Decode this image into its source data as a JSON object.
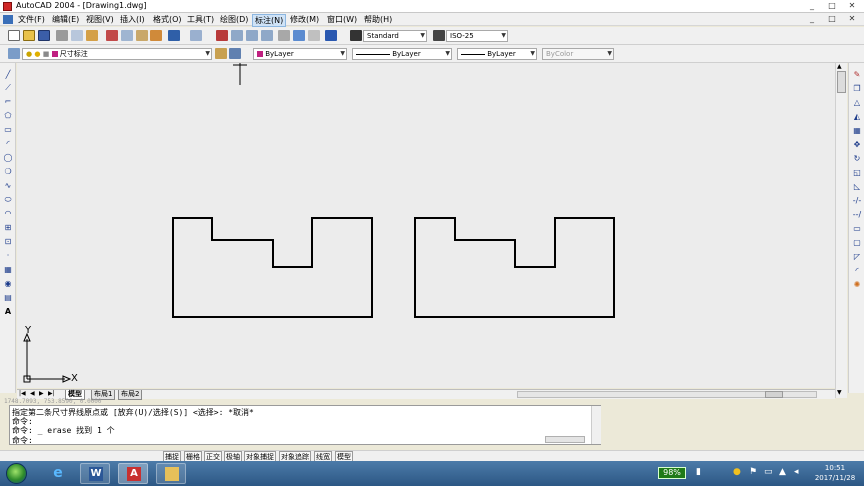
{
  "window": {
    "title": "AutoCAD 2004 - [Drawing1.dwg]",
    "controls": [
      "_",
      "□",
      "✕"
    ],
    "doc_controls": [
      "_",
      "□",
      "✕"
    ]
  },
  "menu": [
    "文件(F)",
    "编辑(E)",
    "视图(V)",
    "插入(I)",
    "格式(O)",
    "工具(T)",
    "绘图(D)",
    "标注(N)",
    "修改(M)",
    "窗口(W)",
    "帮助(H)"
  ],
  "active_menu": "标注(N)",
  "styles_toolbar": {
    "text_style": "Standard",
    "dim_style": "ISO-25"
  },
  "properties_toolbar": {
    "layer": "尺寸标注",
    "color": "ByLayer",
    "linetype": "ByLayer",
    "lineweight": "ByLayer",
    "plotstyle": "ByColor",
    "layer_color": "#c02080"
  },
  "ucs": {
    "x_label": "X",
    "y_label": "Y"
  },
  "tabs": [
    "模型",
    "布局1",
    "布局2"
  ],
  "active_tab": "模型",
  "command_lines": [
    "指定第二条尺寸界线原点或 [放弃(U)/选择(S)] <选择>: *取消*",
    "命令:",
    "命令: _ erase 找到 1 个",
    "命令:"
  ],
  "coords": "1748.7093, 753.8590, 0.0000",
  "status": [
    "捕捉",
    "栅格",
    "正交",
    "极轴",
    "对象捕捉",
    "对象追踪",
    "线宽",
    "模型"
  ],
  "taskbar": {
    "battery": "98%",
    "time": "10:51",
    "date": "2017/11/28"
  },
  "colors": {
    "canvas": "#ececec",
    "taskbar": "#2c5784",
    "active_menu": "#cfe3f7"
  },
  "left_tool_icons": [
    "line-icon",
    "construction-line-icon",
    "polyline-icon",
    "polygon-icon",
    "rectangle-icon",
    "arc-icon",
    "circle-icon",
    "revision-cloud-icon",
    "spline-icon",
    "ellipse-icon",
    "ellipse-arc-icon",
    "insert-block-icon",
    "make-block-icon",
    "point-icon",
    "hatch-icon",
    "region-icon",
    "table-icon",
    "mtext-icon"
  ],
  "right_tool_icons": [
    "erase-icon",
    "copy-icon",
    "mirror-icon",
    "offset-icon",
    "array-icon",
    "move-icon",
    "rotate-icon",
    "scale-icon",
    "stretch-icon",
    "trim-icon",
    "extend-icon",
    "break-icon",
    "join-icon",
    "chamfer-icon",
    "fillet-icon",
    "explode-icon"
  ]
}
